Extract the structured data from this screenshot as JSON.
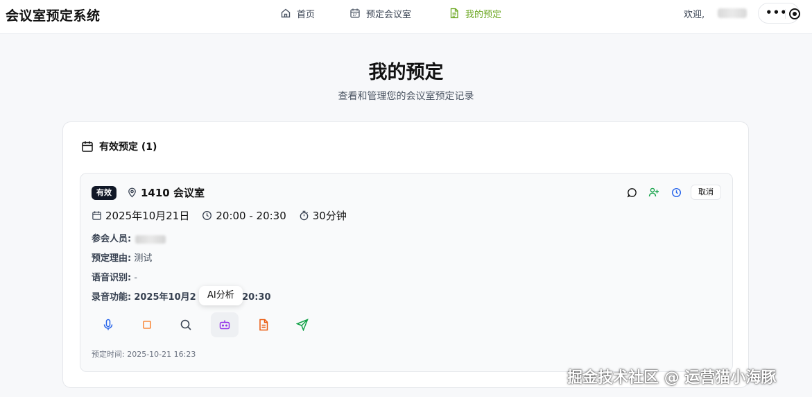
{
  "app": {
    "title": "会议室预定系统",
    "nav": [
      {
        "label": "首页",
        "icon": "home-icon",
        "active": false
      },
      {
        "label": "预定会议室",
        "icon": "calendar-icon",
        "active": false
      },
      {
        "label": "我的预定",
        "icon": "document-icon",
        "active": true
      }
    ],
    "welcome": "欢迎,",
    "more_icon": "more-dots-icon",
    "accent_color": "#6aa61e"
  },
  "page": {
    "title": "我的预定",
    "subtitle": "查看和管理您的会议室预定记录"
  },
  "section": {
    "title": "有效预定 (1)"
  },
  "booking": {
    "status": "有效",
    "room": "1410 会议室",
    "date": "2025年10月21日",
    "time": "20:00 - 20:30",
    "duration": "30分钟",
    "attendees_label": "参会人员:",
    "reason_label": "预定理由:",
    "reason_value": "测试",
    "speech_label": "语音识别:",
    "speech_value": "-",
    "recording_label": "录音功能:",
    "recording_value_left": "2025年10月2",
    "recording_value_right": "0-20:30",
    "tooltip": "AI分析",
    "booked_time": "预定时间: 2025-10-21 16:23",
    "cancel_label": "取消",
    "action_icons": [
      "comment-icon",
      "add-user-icon",
      "clock-icon"
    ],
    "tool_icons": [
      "microphone-icon",
      "stop-icon",
      "search-icon",
      "robot-icon",
      "file-icon",
      "send-icon"
    ]
  },
  "watermark": "掘金技术社区 @ 运营猫小海豚"
}
